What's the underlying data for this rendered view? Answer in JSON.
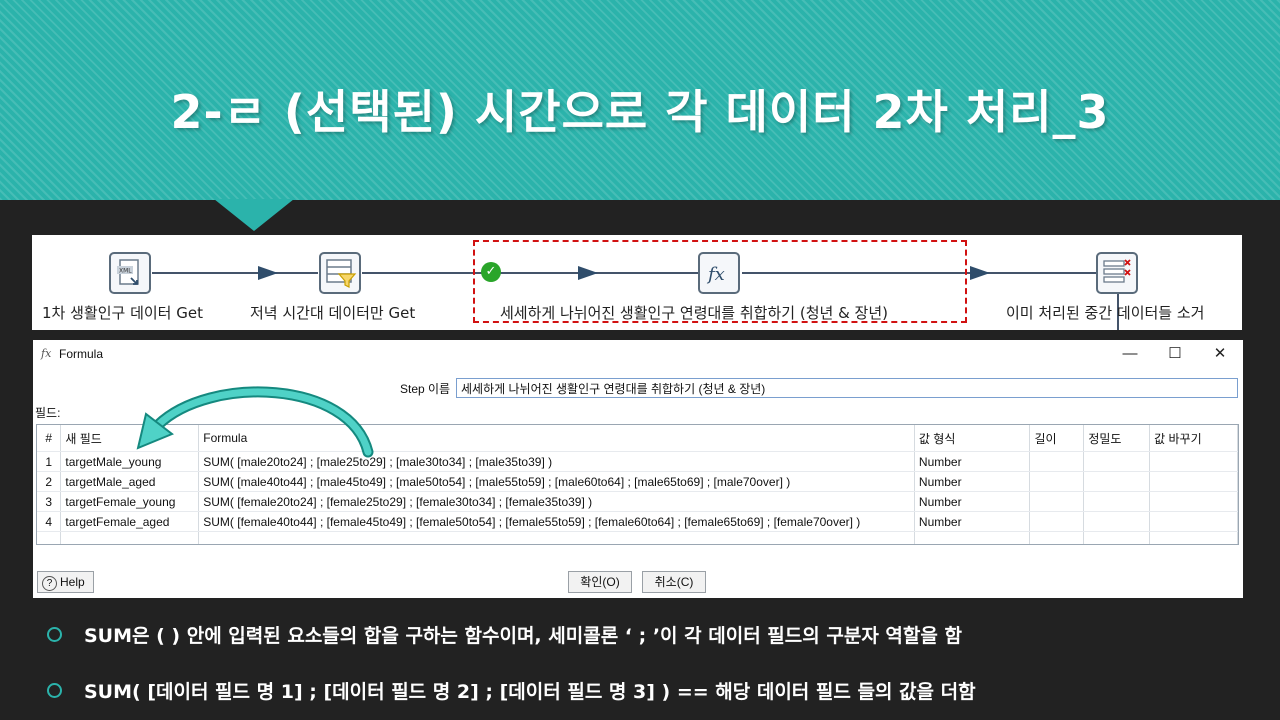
{
  "slide": {
    "title": "2-ㄹ (선택된) 시간으로 각 데이터 2차 처리_3"
  },
  "pipeline": {
    "steps": [
      {
        "label": "1차 생활인구 데이터 Get",
        "icon": "xml-input-icon"
      },
      {
        "label": "저녁 시간대 데이터만 Get",
        "icon": "filter-rows-icon"
      },
      {
        "label": "세세하게 나뉘어진 생활인구 연령대를 취합하기 (청년 & 장년)",
        "icon": "formula-icon"
      },
      {
        "label": "이미 처리된 중간 데이터들 소거",
        "icon": "select-values-icon"
      }
    ],
    "highlight_color": "#d11111"
  },
  "dialog": {
    "icon": "fx",
    "title": "Formula",
    "window_buttons": {
      "minimize": "—",
      "maximize": "☐",
      "close": "✕"
    },
    "step_name_label": "Step 이름",
    "step_name_value": "세세하게 나뉘어진 생활인구 연령대를 취합하기 (청년 & 장년)",
    "fields_label": "필드:",
    "columns": [
      "#",
      "새 필드",
      "Formula",
      "값 형식",
      "길이",
      "정밀도",
      "값 바꾸기"
    ],
    "rows": [
      {
        "num": "1",
        "field": "targetMale_young",
        "formula": "SUM(  [male20to24] ;  [male25to29] ; [male30to34] ; [male35to39]  )",
        "type": "Number"
      },
      {
        "num": "2",
        "field": "targetMale_aged",
        "formula": "SUM( [male40to44] ; [male45to49] ; [male50to54] ; [male55to59] ; [male60to64] ; [male65to69] ; [male70over] )",
        "type": "Number"
      },
      {
        "num": "3",
        "field": "targetFemale_young",
        "formula": "SUM(  [female20to24] ;  [female25to29] ; [female30to34] ; [female35to39]  )",
        "type": "Number"
      },
      {
        "num": "4",
        "field": "targetFemale_aged",
        "formula": "SUM( [female40to44] ; [female45to49] ; [female50to54] ; [female55to59] ; [female60to64] ; [female65to69] ; [female70over] )",
        "type": "Number"
      }
    ],
    "help_label": "Help",
    "ok_label": "확인(O)",
    "cancel_label": "취소(C)"
  },
  "bullets": [
    "SUM은 ( ) 안에 입력된 요소들의 합을 구하는 함수이며, 세미콜론 ‘ ; ’이 각 데이터 필드의 구분자 역할을 함",
    "SUM( [데이터 필드 명 1] ; [데이터 필드 명 2] ; [데이터 필드 명 3] ) == 해당 데이터 필드 들의 값을 더함"
  ],
  "colors": {
    "accent": "#2bb3ab",
    "background": "#222222",
    "check": "#2aa52a"
  }
}
